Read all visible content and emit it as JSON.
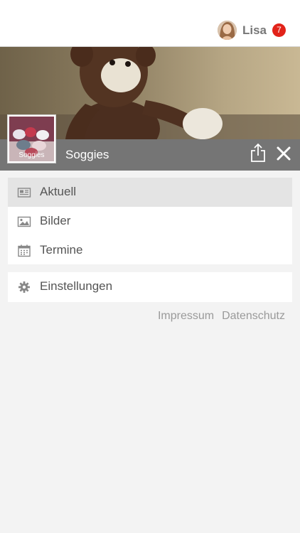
{
  "user": {
    "name": "Lisa",
    "notifications": "7"
  },
  "group": {
    "name": "Soggies",
    "thumb_label": "Soggies"
  },
  "menu": [
    {
      "label": "Aktuell",
      "icon": "newspaper-icon",
      "active": true
    },
    {
      "label": "Bilder",
      "icon": "image-icon",
      "active": false
    },
    {
      "label": "Termine",
      "icon": "calendar-icon",
      "active": false
    }
  ],
  "settings": {
    "label": "Einstellungen",
    "icon": "gear-icon"
  },
  "footer": {
    "impressum": "Impressum",
    "datenschutz": "Datenschutz"
  },
  "colors": {
    "badge": "#e2231a",
    "titlebar": "#757575",
    "background": "#f3f3f3"
  }
}
